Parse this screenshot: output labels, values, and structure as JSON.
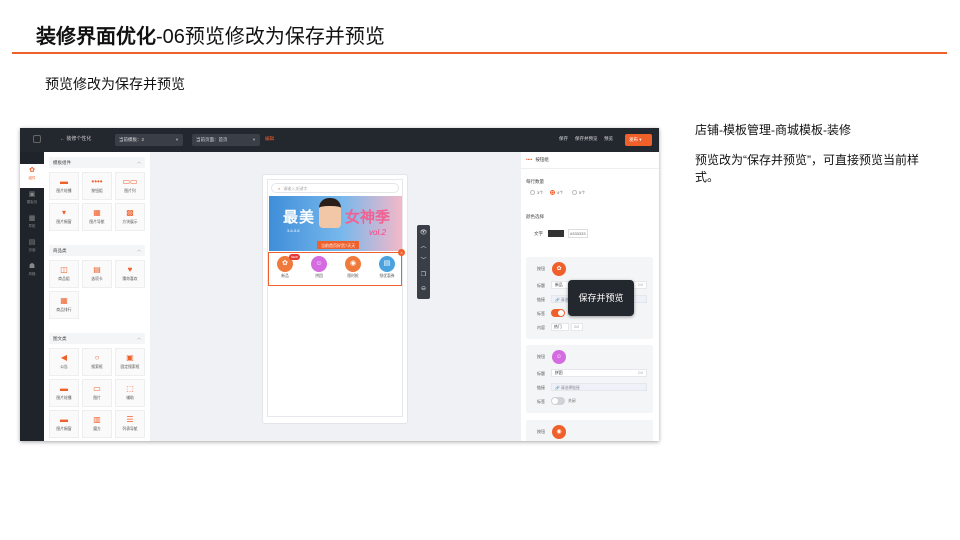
{
  "slide": {
    "title_bold": "装修界面优化",
    "title_rest": "-06预览修改为保存并预览",
    "subtitle": "预览修改为保存并预览",
    "note_path": "店铺-模板管理-商城模板-装修",
    "note_desc": "预览改为“保存并预览”，可直接预览当前样式。"
  },
  "app": {
    "back_label": "← 装修个性化",
    "template_select": "当前模板：2",
    "page_select": "当前页面：首页",
    "edit_link": "编辑",
    "save_label": "保存",
    "save_preview_label": "保存并预览",
    "preview_label": "预览",
    "publish_label": "发布",
    "left_nav": [
      {
        "icon": "✿",
        "label": "组件"
      },
      {
        "icon": "▣",
        "label": "模板页"
      },
      {
        "icon": "▦",
        "label": "导航"
      },
      {
        "icon": "▤",
        "label": "页面"
      },
      {
        "icon": "☗",
        "label": "风格"
      }
    ],
    "groups": [
      {
        "title": "模板组件",
        "items": [
          {
            "icon": "▬",
            "label": "图片轮播"
          },
          {
            "icon": "••••",
            "label": "按钮组"
          },
          {
            "icon": "▭▭",
            "label": "图片列"
          },
          {
            "icon": "▾",
            "label": "图片橱窗"
          },
          {
            "icon": "▦",
            "label": "图片导航"
          },
          {
            "icon": "▩",
            "label": "方块展示"
          }
        ]
      },
      {
        "title": "商品类",
        "items": [
          {
            "icon": "◫",
            "label": "商品组"
          },
          {
            "icon": "▤",
            "label": "选项卡"
          },
          {
            "icon": "♥",
            "label": "猜你喜欢"
          },
          {
            "icon": "▦",
            "label": "商品排行"
          }
        ]
      },
      {
        "title": "图文类",
        "items": [
          {
            "icon": "◀",
            "label": "公告"
          },
          {
            "icon": "○",
            "label": "搜索框"
          },
          {
            "icon": "▣",
            "label": "固定搜索框"
          },
          {
            "icon": "▬",
            "label": "图片轮播"
          },
          {
            "icon": "▭",
            "label": "图片"
          },
          {
            "icon": "⬚",
            "label": "辅助"
          },
          {
            "icon": "▬",
            "label": "图片橱窗"
          },
          {
            "icon": "▥",
            "label": "魔方"
          },
          {
            "icon": "☰",
            "label": "列表导航"
          }
        ]
      }
    ],
    "phone": {
      "search_placeholder": "请输入关键字",
      "banner_text_1": "最美",
      "banner_text_2": "女神季",
      "banner_text_3": "3.6-3.8",
      "banner_text_4": "vol.2",
      "banner_tag": "当前首页好货7天天",
      "nav_badge": "NEW",
      "nav_items": [
        {
          "icon": "✿",
          "label": "新品",
          "color": "#f07a3c"
        },
        {
          "icon": "☺",
          "label": "拼团",
          "color": "#d46be0"
        },
        {
          "icon": "◉",
          "label": "限时抢",
          "color": "#f07a3c"
        },
        {
          "icon": "▤",
          "label": "领优惠券",
          "color": "#4aa3df"
        }
      ]
    },
    "tools": [
      "👁",
      "︿",
      "﹀",
      "❐",
      "⊖"
    ],
    "props": {
      "header_title": "按钮组",
      "tooltip": "保存并预览",
      "per_row_label": "每行数量",
      "per_row_options": [
        "3个",
        "4个",
        "5个"
      ],
      "color_label": "颜色选择",
      "text_label": "文字",
      "text_color_hex": "#333333",
      "cards": [
        {
          "icon_label": "按钮",
          "title_label": "标题",
          "title_value": "新品",
          "title_count": "2/4",
          "link_label": "链接",
          "link_value": "🔗 请选择链接",
          "badge_label": "标签",
          "badge_state": "开启",
          "badge_on": true,
          "content_label": "内容",
          "content_value": "热门",
          "content_count": "2/2"
        },
        {
          "icon_label": "按钮",
          "title_label": "标题",
          "title_value": "拼团",
          "title_count": "2/4",
          "link_label": "链接",
          "link_value": "🔗 请选择链接",
          "badge_label": "标签",
          "badge_state": "关闭",
          "badge_on": false
        },
        {
          "icon_label": "按钮"
        }
      ]
    }
  }
}
